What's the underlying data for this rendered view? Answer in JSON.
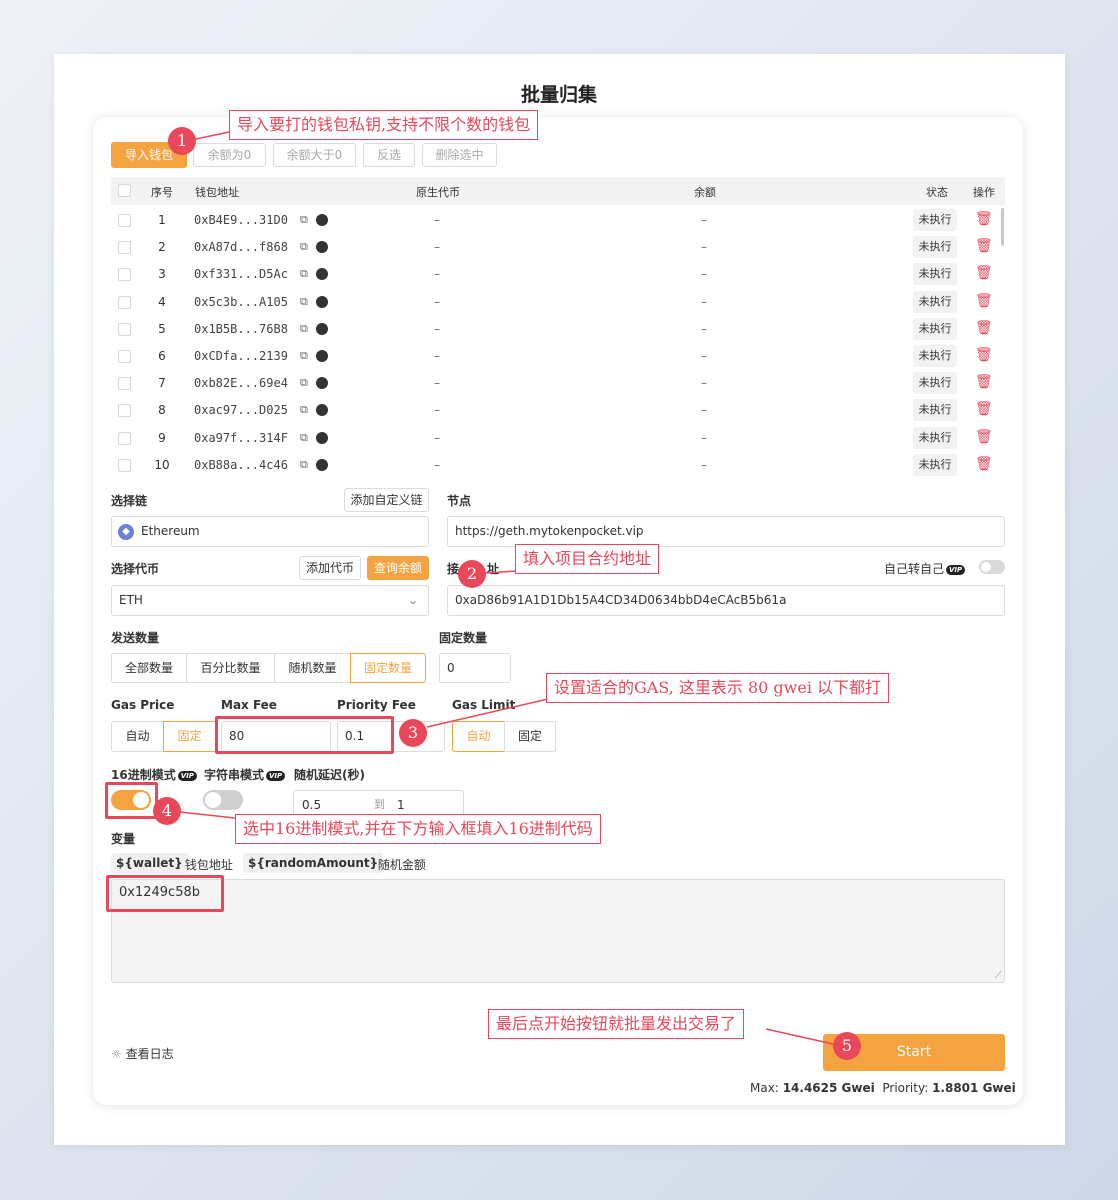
{
  "title": "批量归集",
  "toolbar": {
    "import_label": "导入钱包",
    "balance_zero_label": "余额为0",
    "balance_gt_zero_label": "余额大于0",
    "invert_label": "反选",
    "delete_selected_label": "删除选中"
  },
  "table": {
    "headers": {
      "index": "序号",
      "address": "钱包地址",
      "native": "原生代币",
      "balance": "余额",
      "status": "状态",
      "action": "操作"
    },
    "rows": [
      {
        "index": "1",
        "address": "0xB4E9...31D0",
        "native": "–",
        "balance": "–",
        "status": "未执行"
      },
      {
        "index": "2",
        "address": "0xA87d...f868",
        "native": "–",
        "balance": "–",
        "status": "未执行"
      },
      {
        "index": "3",
        "address": "0xf331...D5Ac",
        "native": "–",
        "balance": "–",
        "status": "未执行"
      },
      {
        "index": "4",
        "address": "0x5c3b...A105",
        "native": "–",
        "balance": "–",
        "status": "未执行"
      },
      {
        "index": "5",
        "address": "0x1B5B...76B8",
        "native": "–",
        "balance": "–",
        "status": "未执行"
      },
      {
        "index": "6",
        "address": "0xCDfa...2139",
        "native": "–",
        "balance": "–",
        "status": "未执行"
      },
      {
        "index": "7",
        "address": "0xb82E...69e4",
        "native": "–",
        "balance": "–",
        "status": "未执行"
      },
      {
        "index": "8",
        "address": "0xac97...D025",
        "native": "–",
        "balance": "–",
        "status": "未执行"
      },
      {
        "index": "9",
        "address": "0xa97f...314F",
        "native": "–",
        "balance": "–",
        "status": "未执行"
      },
      {
        "index": "10",
        "address": "0xB88a...4c46",
        "native": "–",
        "balance": "–",
        "status": "未执行"
      }
    ]
  },
  "chain": {
    "label": "选择链",
    "add_custom_label": "添加自定义链",
    "value": "Ethereum"
  },
  "node": {
    "label": "节点",
    "value": "https://geth.mytokenpocket.vip"
  },
  "token": {
    "label": "选择代币",
    "add_label": "添加代币",
    "query_label": "查询余额",
    "value": "ETH"
  },
  "receive": {
    "label_prefix": "接",
    "label_suffix": "址",
    "self_label": "自己转自己",
    "vip": "VIP",
    "value": "0xaD86b91A1D1Db15A4CD34D0634bbD4eCAcB5b61a"
  },
  "send_amount": {
    "label": "发送数量",
    "options": [
      "全部数量",
      "百分比数量",
      "随机数量",
      "固定数量"
    ],
    "selected": "固定数量"
  },
  "fixed_amount": {
    "label": "固定数量",
    "value": "0"
  },
  "gas": {
    "price_label": "Gas Price",
    "max_fee_label": "Max Fee",
    "priority_fee_label": "Priority Fee",
    "limit_label": "Gas Limit",
    "price_auto": "自动",
    "price_fixed": "固定",
    "max_fee": "80",
    "priority_fee": "0.1",
    "limit_auto": "自动",
    "limit_fixed": "固定"
  },
  "modes": {
    "hex_label": "16进制模式",
    "string_label": "字符串模式",
    "delay_label": "随机延迟(秒)",
    "vip": "VIP",
    "delay_from": "0.5",
    "delay_to_label": "到",
    "delay_to": "1",
    "hex_on": true,
    "string_on": false
  },
  "variables": {
    "label": "变量",
    "wallet_chip": "${wallet}",
    "wallet_desc": ": 钱包地址",
    "amount_chip": "${randomAmount}",
    "amount_desc": ": 随机金额"
  },
  "data_input": {
    "value": "0x1249c58b"
  },
  "log_label": "查看日志",
  "start_label": "Start",
  "gas_info": {
    "max_label": "Max:",
    "max_value": "14.4625 Gwei",
    "priority_label": "Priority:",
    "priority_value": "1.8801 Gwei"
  },
  "annotations": {
    "n1": "1",
    "t1": "导入要打的钱包私钥,支持不限个数的钱包",
    "n2": "2",
    "t2": "填入项目合约地址",
    "n3": "3",
    "t3": "设置适合的GAS, 这里表示 80 gwei 以下都打",
    "n4": "4",
    "t4": "选中16进制模式,并在下方输入框填入16进制代码",
    "n5": "5",
    "t5": "最后点开始按钮就批量发出交易了"
  },
  "colors": {
    "accent": "#f4a340",
    "annotation": "#e8485a",
    "delete": "#e8485a"
  }
}
